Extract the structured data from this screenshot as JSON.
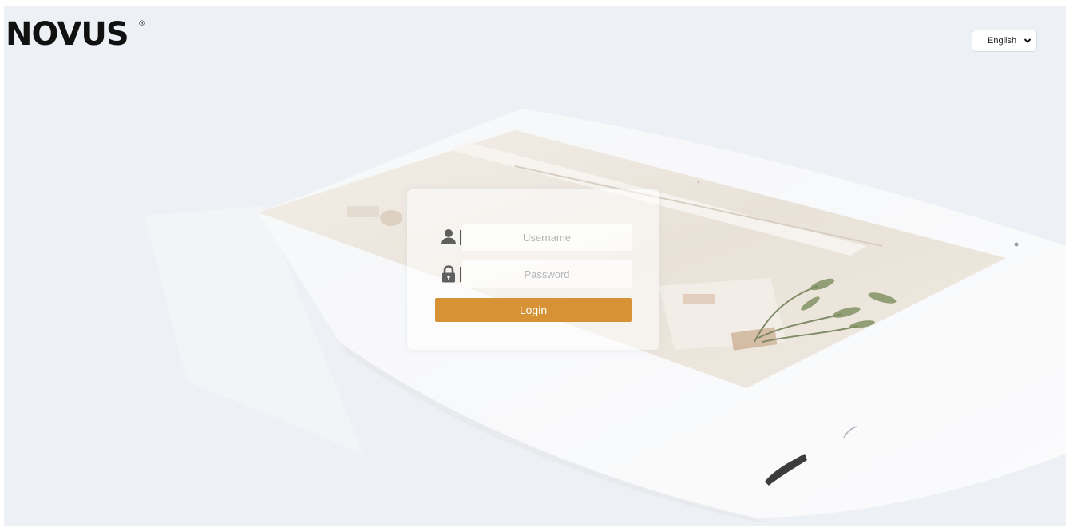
{
  "brand": {
    "logo_text": "NOVUS",
    "registered_mark": "®"
  },
  "language": {
    "selected": "English",
    "options": [
      "English"
    ]
  },
  "login": {
    "username_placeholder": "Username",
    "password_placeholder": "Password",
    "button_label": "Login"
  },
  "icons": {
    "user": "user-icon",
    "lock": "lock-icon",
    "dropdown": "chevron-down-icon"
  },
  "colors": {
    "background": "#edf0f5",
    "accent": "#d69235",
    "logo": "#111111"
  }
}
